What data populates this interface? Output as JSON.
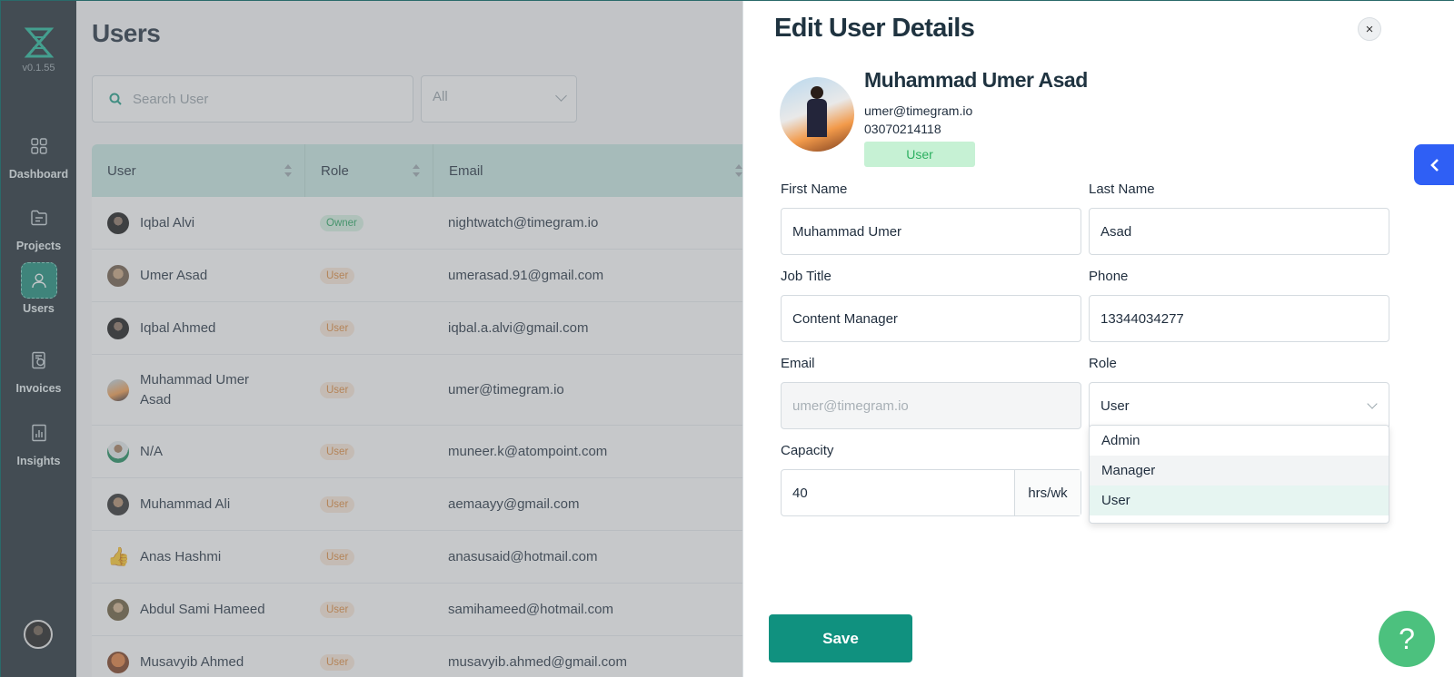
{
  "sidebar": {
    "version": "v0.1.55",
    "items": [
      {
        "label": "Dashboard",
        "icon": "dashboard-icon"
      },
      {
        "label": "Projects",
        "icon": "projects-icon"
      },
      {
        "label": "Users",
        "icon": "users-icon",
        "active": true
      },
      {
        "label": "Invoices",
        "icon": "invoices-icon"
      },
      {
        "label": "Insights",
        "icon": "insights-icon"
      }
    ]
  },
  "users_page": {
    "title": "Users",
    "search_placeholder": "Search User",
    "filter_value": "All",
    "columns": [
      "User",
      "Role",
      "Email"
    ],
    "rows": [
      {
        "name": "Iqbal Alvi",
        "role": "Owner",
        "email": "nightwatch@timegram.io"
      },
      {
        "name": "Umer Asad",
        "role": "User",
        "email": "umerasad.91@gmail.com"
      },
      {
        "name": "Iqbal Ahmed",
        "role": "User",
        "email": "iqbal.a.alvi@gmail.com"
      },
      {
        "name": "Muhammad Umer Asad",
        "role": "User",
        "email": "umer@timegram.io"
      },
      {
        "name": "N/A",
        "role": "User",
        "email": "muneer.k@atompoint.com"
      },
      {
        "name": "Muhammad Ali",
        "role": "User",
        "email": "aemaayy@gmail.com"
      },
      {
        "name": "Anas Hashmi",
        "role": "User",
        "email": "anasusaid@hotmail.com"
      },
      {
        "name": "Abdul Sami Hameed",
        "role": "User",
        "email": "samihameed@hotmail.com"
      },
      {
        "name": "Musavyib Ahmed",
        "role": "User",
        "email": "musavyib.ahmed@gmail.com"
      }
    ]
  },
  "drawer": {
    "title": "Edit User Details",
    "close_label": "×",
    "profile": {
      "name": "Muhammad Umer Asad",
      "email": "umer@timegram.io",
      "phone": "03070214118",
      "role": "User"
    },
    "form": {
      "first_name_label": "First Name",
      "first_name_value": "Muhammad Umer",
      "last_name_label": "Last Name",
      "last_name_value": "Asad",
      "job_title_label": "Job Title",
      "job_title_value": "Content Manager",
      "phone_label": "Phone",
      "phone_value": "13344034277",
      "email_label": "Email",
      "email_value": "umer@timegram.io",
      "role_label": "Role",
      "role_value": "User",
      "capacity_label": "Capacity",
      "capacity_value": "40",
      "capacity_unit": "hrs/wk"
    },
    "role_options": [
      "Admin",
      "Manager",
      "User"
    ],
    "save_label": "Save"
  },
  "help_label": "?",
  "colors": {
    "sidebar_bg": "#1e2a33",
    "accent": "#10917f",
    "collapse_button": "#2f5ff5",
    "help_button": "#4cc17e"
  }
}
